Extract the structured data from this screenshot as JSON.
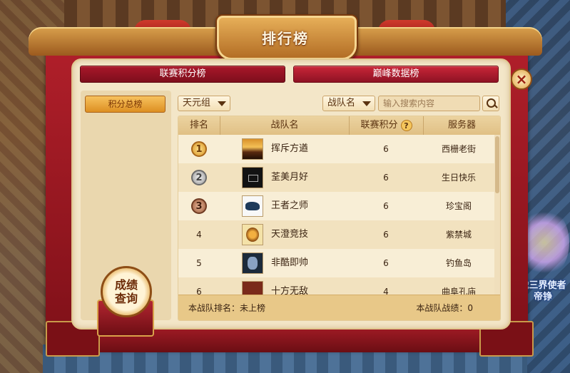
{
  "window": {
    "title": "排行榜"
  },
  "tabs": [
    {
      "label": "联赛积分榜",
      "active": true
    },
    {
      "label": "巅峰数据榜",
      "active": false
    }
  ],
  "sidebar": {
    "items": [
      {
        "label": "积分总榜",
        "selected": true
      }
    ]
  },
  "filters": {
    "group_select": "天元组",
    "field_select": "战队名",
    "search_placeholder": "输入搜索内容"
  },
  "table": {
    "headers": {
      "rank": "排名",
      "team": "战队名",
      "score": "联赛积分",
      "server": "服务器"
    },
    "score_help_glyph": "?",
    "rows": [
      {
        "rank": "1",
        "team": "挥斥方遒",
        "score": "6",
        "server": "西栅老街",
        "logo_icon": "sunset-logo-icon"
      },
      {
        "rank": "2",
        "team": "荃美月好",
        "score": "6",
        "server": "生日快乐",
        "logo_icon": "dark-emblem-logo-icon"
      },
      {
        "rank": "3",
        "team": "王者之师",
        "score": "6",
        "server": "珍宝阁",
        "logo_icon": "panther-logo-icon"
      },
      {
        "rank": "4",
        "team": "天澄竞技",
        "score": "6",
        "server": "紫禁城",
        "logo_icon": "lion-logo-icon"
      },
      {
        "rank": "5",
        "team": "非酷即帅",
        "score": "6",
        "server": "钓鱼岛",
        "logo_icon": "portrait-logo-icon"
      },
      {
        "rank": "6",
        "team": "十方无敌",
        "score": "4",
        "server": "曲阜孔庙",
        "logo_icon": "red-emblem-logo-icon"
      }
    ]
  },
  "footer": {
    "my_rank_label": "本战队排名：未上榜",
    "my_record_label": "本战队战绩：0"
  },
  "query_button": {
    "label": "成绩查询"
  },
  "close_glyph": "×",
  "scene": {
    "character_name": "战三界使者\n帝铮"
  },
  "colors": {
    "accent": "#a8172a",
    "gold": "#e7b562",
    "panel": "#f3e6c8"
  }
}
